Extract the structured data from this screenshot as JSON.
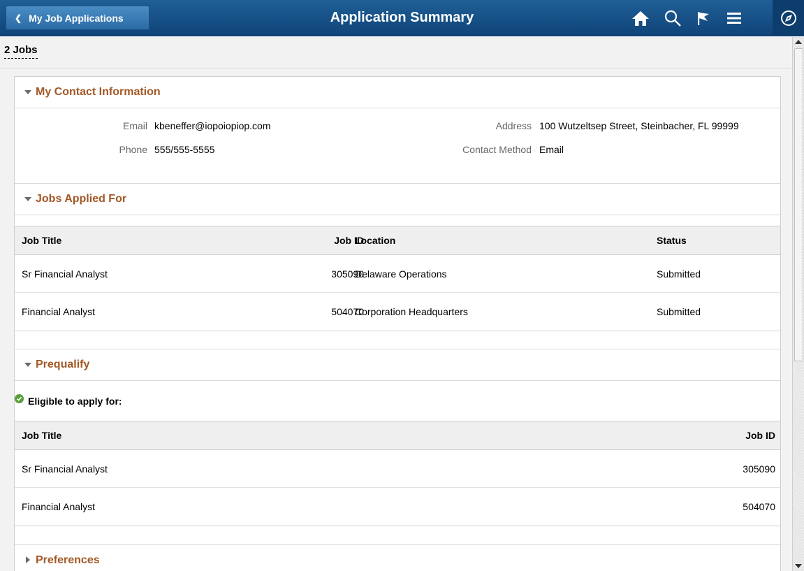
{
  "header": {
    "back_label": "My Job Applications",
    "title": "Application Summary",
    "icons": [
      "home-icon",
      "search-icon",
      "flag-icon",
      "menu-icon",
      "navbar-compass-icon"
    ]
  },
  "subheader": {
    "jobs_count": "2 Jobs"
  },
  "contact": {
    "section_title": "My Contact Information",
    "email_label": "Email",
    "email_value": "kbeneffer@iopoiopiop.com",
    "phone_label": "Phone",
    "phone_value": "555/555-5555",
    "address_label": "Address",
    "address_value": "100 Wutzeltsep Street, Steinbacher, FL 99999",
    "method_label": "Contact Method",
    "method_value": "Email"
  },
  "jobs_applied": {
    "section_title": "Jobs Applied For",
    "headers": {
      "title": "Job Title",
      "id": "Job ID",
      "location": "Location",
      "status": "Status"
    },
    "rows": [
      {
        "title": "Sr Financial Analyst",
        "id": "305090",
        "location": "Delaware Operations",
        "status": "Submitted"
      },
      {
        "title": "Financial Analyst",
        "id": "504070",
        "location": "Corporation Headquarters",
        "status": "Submitted"
      }
    ]
  },
  "prequalify": {
    "section_title": "Prequalify",
    "eligible_label": "Eligible to apply for:",
    "headers": {
      "title": "Job Title",
      "id": "Job ID"
    },
    "rows": [
      {
        "title": "Sr Financial Analyst",
        "id": "305090"
      },
      {
        "title": "Financial Analyst",
        "id": "504070"
      }
    ]
  },
  "preferences": {
    "section_title": "Preferences"
  },
  "colors": {
    "header_bg": "#15528a",
    "section_title": "#a35826",
    "check": "#5a9e3a"
  }
}
